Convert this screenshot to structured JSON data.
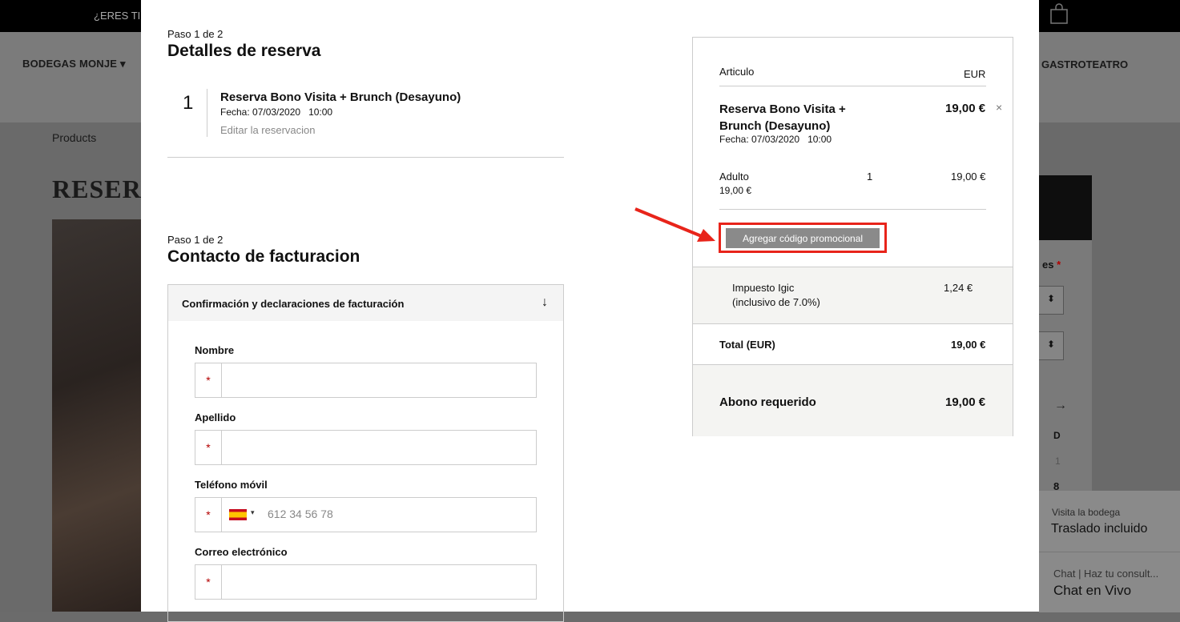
{
  "background": {
    "topbar_text": "¿ERES TI",
    "nav_brand": "BODEGAS MONJE",
    "nav_right": "GASTROTEATRO",
    "breadcrumb": "Products",
    "heading_partial": "RESERV",
    "right_panel": {
      "label": "es",
      "required_mark": "*",
      "day_header": "D",
      "day_one": "1",
      "day_eight": "8"
    },
    "visit_card": {
      "line1": "Visita la bodega",
      "line2": "Traslado incluido"
    },
    "chat_card": {
      "line1": "Chat | Haz tu consult...",
      "line2": "Chat en Vivo"
    }
  },
  "modal": {
    "section1": {
      "step": "Paso 1 de 2",
      "title": "Detalles de reserva",
      "reservation": {
        "number": "1",
        "name": "Reserva Bono Visita + Brunch (Desayuno)",
        "date": "Fecha: 07/03/2020   10:00",
        "edit_label": "Editar la reservacion"
      }
    },
    "section2": {
      "step": "Paso 1 de 2",
      "title": "Contacto de facturacion",
      "accordion_label": "Confirmación y declaraciones de facturación",
      "accordion_icon": "arrow-down-icon",
      "fields": {
        "first_name": {
          "label": "Nombre",
          "required": "*"
        },
        "last_name": {
          "label": "Apellido",
          "required": "*"
        },
        "mobile": {
          "label": "Teléfono móvil",
          "required": "*",
          "placeholder": "612 34 56 78",
          "country_caret": "▾"
        },
        "email": {
          "label": "Correo electrónico",
          "required": "*"
        }
      }
    }
  },
  "summary": {
    "article_header": "Articulo",
    "currency_header": "EUR",
    "item_name": "Reserva Bono Visita + Brunch (Desayuno)",
    "item_price": "19,00 €",
    "item_date": "Fecha: 07/03/2020   10:00",
    "remove_symbol": "×",
    "adult_label": "Adulto",
    "adult_qty": "1",
    "adult_price": "19,00 €",
    "adult_unit": "19,00 €",
    "promo_button": "Agregar código promocional",
    "tax_label": "Impuesto Igic",
    "tax_note": "(inclusivo de 7.0%)",
    "tax_value": "1,24 €",
    "total_label": "Total (EUR)",
    "total_value": "19,00 €",
    "deposit_label": "Abono requerido",
    "deposit_value": "19,00 €"
  },
  "colors": {
    "annotation_red": "#e8241a",
    "promo_button_bg": "#8a8a8a",
    "required_red": "#b40000"
  }
}
